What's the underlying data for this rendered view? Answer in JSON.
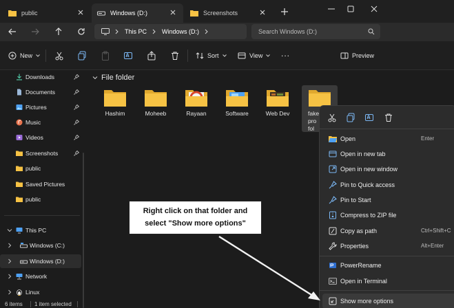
{
  "tabs": [
    {
      "label": "public"
    },
    {
      "label": "Windows (D:)"
    },
    {
      "label": "Screenshots"
    }
  ],
  "address": {
    "root": "This PC",
    "location": "Windows (D:)"
  },
  "search": {
    "placeholder": "Search Windows (D:)"
  },
  "toolbar": {
    "new_label": "New",
    "sort_label": "Sort",
    "view_label": "View",
    "more_label": "...",
    "preview_label": "Preview"
  },
  "sidebar": {
    "quick_access": [
      {
        "label": "Downloads",
        "icon": "download-icon",
        "pinned": true
      },
      {
        "label": "Documents",
        "icon": "document-icon",
        "pinned": true
      },
      {
        "label": "Pictures",
        "icon": "pictures-icon",
        "pinned": true
      },
      {
        "label": "Music",
        "icon": "music-icon",
        "pinned": true
      },
      {
        "label": "Videos",
        "icon": "video-icon",
        "pinned": true
      },
      {
        "label": "Screenshots",
        "icon": "folder-icon",
        "pinned": true
      },
      {
        "label": "public",
        "icon": "folder-icon",
        "pinned": false
      },
      {
        "label": "Saved Pictures",
        "icon": "folder-icon",
        "pinned": false
      },
      {
        "label": "public",
        "icon": "folder-icon",
        "pinned": false
      }
    ],
    "this_pc": "This PC",
    "drive_c": "Windows (C:)",
    "drive_d": "Windows (D:)",
    "network": "Network",
    "linux": "Linux"
  },
  "content": {
    "section_label": "File folder",
    "folders": [
      {
        "name": "Hashim"
      },
      {
        "name": "Moheeb"
      },
      {
        "name": "Rayaan"
      },
      {
        "name": "Software"
      },
      {
        "name": "Web Dev"
      },
      {
        "name": "fake pro fol"
      }
    ]
  },
  "context_menu": {
    "items": [
      {
        "label": "Open",
        "shortcut": "Enter",
        "icon": "open-folder-icon"
      },
      {
        "label": "Open in new tab",
        "shortcut": "",
        "icon": "new-tab-icon"
      },
      {
        "label": "Open in new window",
        "shortcut": "",
        "icon": "new-window-icon"
      },
      {
        "label": "Pin to Quick access",
        "shortcut": "",
        "icon": "pin-icon"
      },
      {
        "label": "Pin to Start",
        "shortcut": "",
        "icon": "pin-icon"
      },
      {
        "label": "Compress to ZIP file",
        "shortcut": "",
        "icon": "zip-icon"
      },
      {
        "label": "Copy as path",
        "shortcut": "Ctrl+Shift+C",
        "icon": "path-icon"
      },
      {
        "label": "Properties",
        "shortcut": "Alt+Enter",
        "icon": "wrench-icon"
      },
      {
        "label": "PowerRename",
        "shortcut": "",
        "icon": "power-rename-icon"
      },
      {
        "label": "Open in Terminal",
        "shortcut": "",
        "icon": "terminal-icon"
      },
      {
        "label": "Show more options",
        "shortcut": "",
        "icon": "more-options-icon"
      }
    ]
  },
  "annotation": {
    "line1": "Right click on that folder and",
    "line2": "select \"Show more options\""
  },
  "status": {
    "items": "6 items",
    "selected": "1 item selected"
  },
  "colors": {
    "folder_yellow": "#f6c244",
    "accent_blue": "#4ea1f3"
  }
}
